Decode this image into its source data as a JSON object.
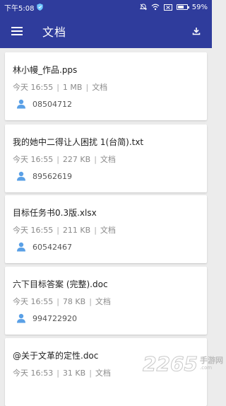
{
  "status_bar": {
    "time": "下午5:08",
    "battery": "59%",
    "battery_level": 0.59
  },
  "app_bar": {
    "title": "文档",
    "menu_icon": "menu-icon",
    "action_icon": "download-icon"
  },
  "documents": [
    {
      "name": "林小幔_作品.pps",
      "date": "今天 16:55",
      "size": "1 MB",
      "type": "文档",
      "owner_id": "08504712"
    },
    {
      "name": "我的她中二得让人困扰 1(台简).txt",
      "date": "今天 16:55",
      "size": "227 KB",
      "type": "文档",
      "owner_id": "89562619"
    },
    {
      "name": "目标任务书0.3版.xlsx",
      "date": "今天 16:55",
      "size": "211 KB",
      "type": "文档",
      "owner_id": "60542467"
    },
    {
      "name": "六下目标答案 (完整).doc",
      "date": "今天 16:55",
      "size": "78 KB",
      "type": "文档",
      "owner_id": "994722920"
    },
    {
      "name": "@关于文革的定性.doc",
      "date": "今天 16:53",
      "size": "31 KB",
      "type": "文档",
      "owner_id": ""
    }
  ],
  "watermark": {
    "number": "2265",
    "cn": "手游网",
    "domain": ".com"
  },
  "colors": {
    "primary": "#2f3c9c",
    "background": "#ececec",
    "person_icon": "#5aa0e6"
  }
}
